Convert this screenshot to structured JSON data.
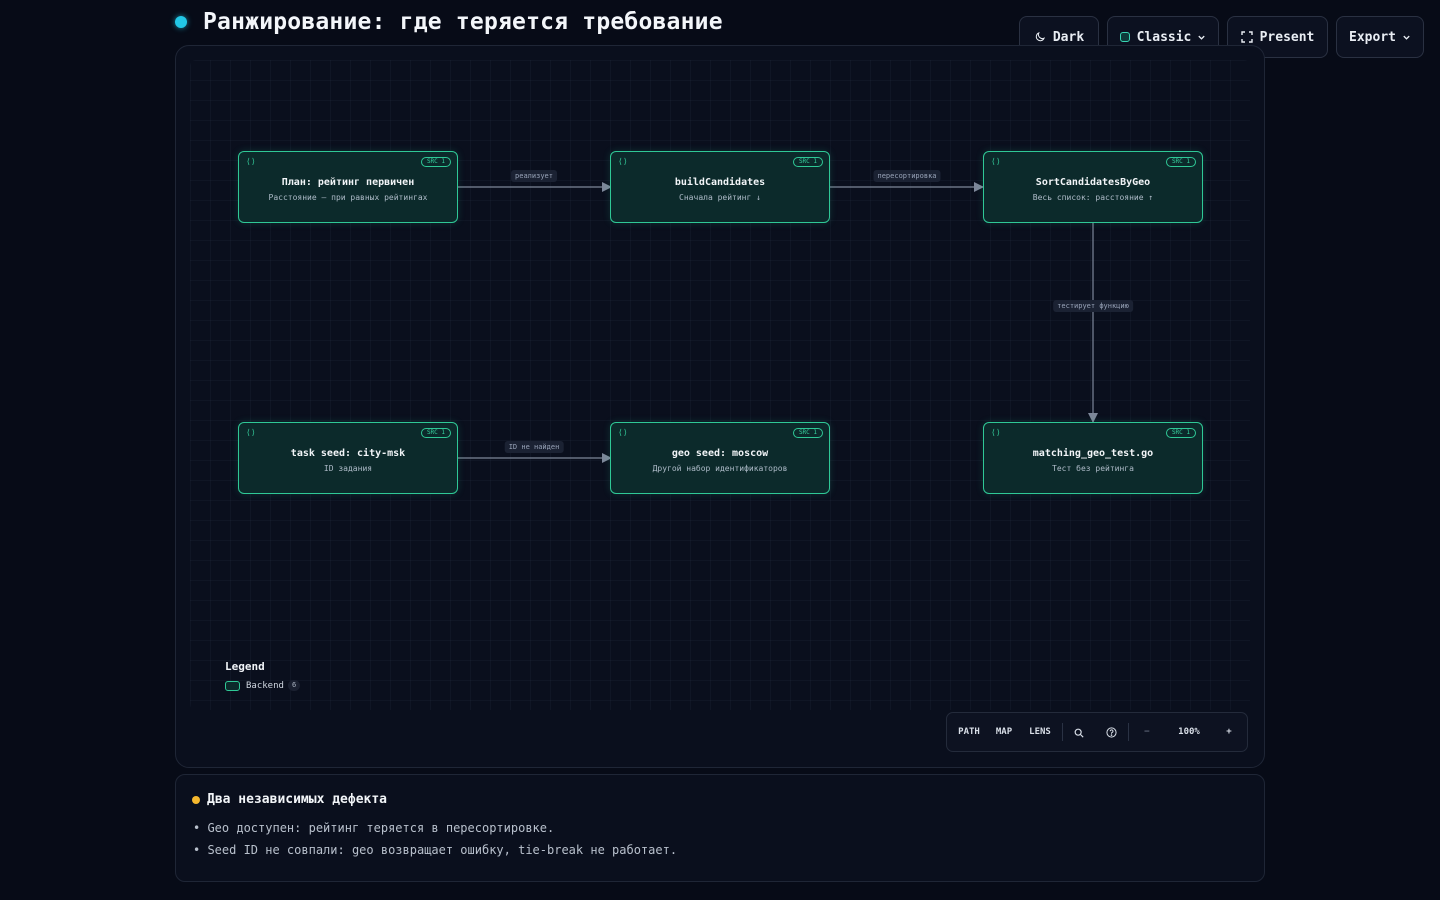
{
  "header": {
    "title": "Ранжирование: где теряется требование"
  },
  "toolbar": {
    "dark_label": "Dark",
    "theme_label": "Classic",
    "present_label": "Present",
    "export_label": "Export"
  },
  "diagram": {
    "nodes": [
      {
        "id": "plan",
        "title": "План: рейтинг первичен",
        "subtitle": "Расстояние — при равных рейтингах",
        "badge": "SRC 1"
      },
      {
        "id": "build",
        "title": "buildCandidates",
        "subtitle": "Сначала рейтинг ↓",
        "badge": "SRC 1"
      },
      {
        "id": "sort",
        "title": "SortCandidatesByGeo",
        "subtitle": "Весь список: расстояние ↑",
        "badge": "SRC 1"
      },
      {
        "id": "task",
        "title": "task seed: city-msk",
        "subtitle": "ID задания",
        "badge": "SRC 1"
      },
      {
        "id": "geo",
        "title": "geo seed: moscow",
        "subtitle": "Другой набор идентификаторов",
        "badge": "SRC 1"
      },
      {
        "id": "test",
        "title": "matching_geo_test.go",
        "subtitle": "Тест без рейтинга",
        "badge": "SRC 1"
      }
    ],
    "edges": [
      {
        "from": "plan",
        "to": "build",
        "label": "реализует"
      },
      {
        "from": "build",
        "to": "sort",
        "label": "пересортировка"
      },
      {
        "from": "sort",
        "to": "test",
        "label": "тестирует функцию"
      },
      {
        "from": "task",
        "to": "geo",
        "label": "ID не найден"
      }
    ],
    "colors": {
      "node_border": "#2fc896",
      "node_fill": "#0c2a2b",
      "edge": "#7d8799"
    }
  },
  "legend": {
    "title": "Legend",
    "items": [
      {
        "label": "Backend",
        "count": "6"
      }
    ]
  },
  "controls": {
    "path_label": "PATH",
    "map_label": "MAP",
    "lens_label": "LENS",
    "zoom_level": "100%",
    "zoom_out": "−",
    "zoom_in": "+"
  },
  "info": {
    "title": "Два независимых дефекта",
    "lines": [
      "• Geo доступен: рейтинг теряется в пересортировке.",
      "• Seed ID не совпали: geo возвращает ошибку, tie-break не работает."
    ]
  },
  "colors": {
    "accent": "#22c7e6",
    "warning": "#f5b82e",
    "background": "#070b17"
  }
}
